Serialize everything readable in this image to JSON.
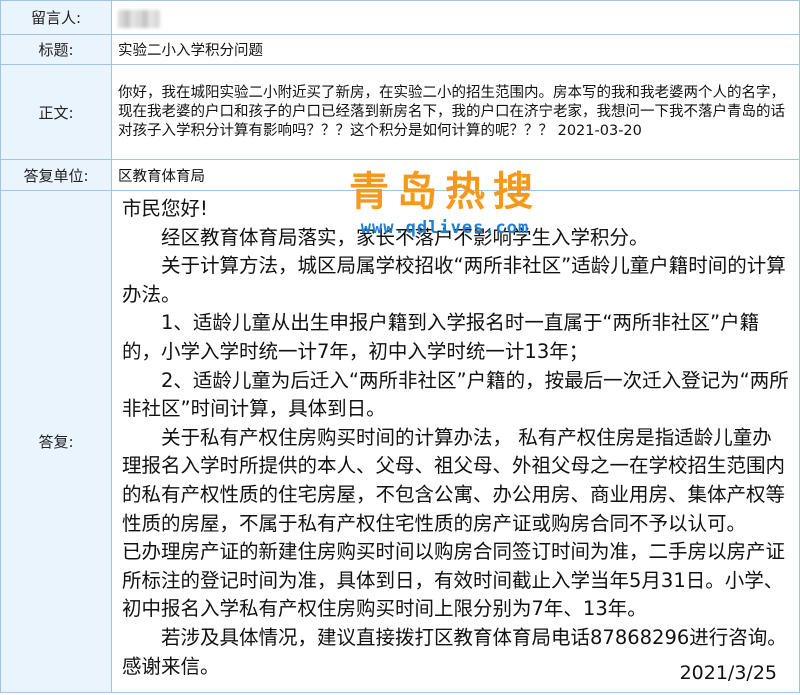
{
  "labels": {
    "author": "留言人:",
    "title": "标题:",
    "body": "正文:",
    "department": "答复单位:",
    "reply": "答复:"
  },
  "message": {
    "title": "实验二小入学积分问题",
    "body": "你好，我在城阳实验二小附近买了新房，在实验二小的招生范围内。房本写的我和我老婆两个人的名字，现在我老婆的户口和孩子的户口已经落到新房名下，我的户口在济宁老家，我想问一下我不落户青岛的话对孩子入学积分计算有影响吗？？？这个积分是如何计算的呢？？？  2021-03-20"
  },
  "department": "区教育体育局",
  "reply": {
    "greeting": "市民您好!",
    "paragraphs": [
      "经区教育体育局落实，家长不落户不影响学生入学积分。",
      "关于计算方法，城区局属学校招收“两所非社区”适龄儿童户籍时间的计算办法。",
      "1、适龄儿童从出生申报户籍到入学报名时一直属于“两所非社区”户籍的，小学入学时统一计7年，初中入学时统一计13年；",
      "2、适龄儿童为后迁入“两所非社区”户籍的，按最后一次迁入登记为“两所非社区”时间计算，具体到日。",
      "关于私有产权住房购买时间的计算办法， 私有产权住房是指适龄儿童办理报名入学时所提供的本人、父母、祖父母、外祖父母之一在学校招生范围内的私有产权性质的住宅房屋，不包含公寓、办公用房、商业用房、集体产权等性质的房屋，不属于私有产权住宅性质的房产证或购房合同不予以认可。"
    ],
    "paragraph_unindented": "已办理房产证的新建住房购买时间以购房合同签订时间为准，二手房以房产证所标注的登记时间为准，具体到日，有效时间截止入学当年5月31日。小学、初中报名入学私有产权住房购买时间上限分别为7年、13年。",
    "closing": "若涉及具体情况，建议直接拨打区教育体育局电话87868296进行咨询。",
    "thanks": "感谢来信。",
    "date": "2021/3/25"
  },
  "watermark": {
    "title": "青岛热搜",
    "url": "www.qdlives.com"
  },
  "colors": {
    "label_bg": "#eaf4fd",
    "border": "#9fc4e6",
    "watermark_title": "#f39a1c",
    "watermark_url": "#1f7fd1"
  }
}
